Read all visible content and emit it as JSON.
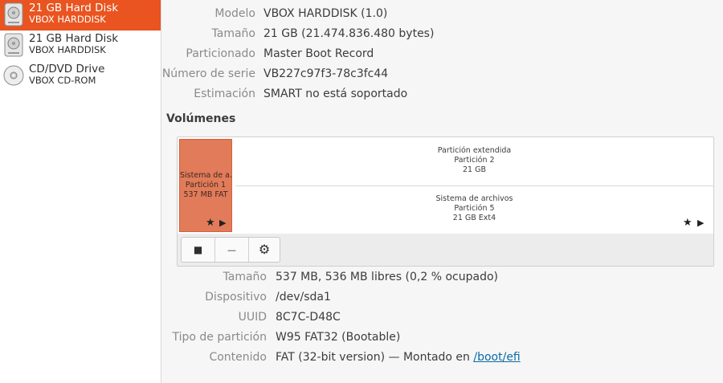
{
  "sidebar": {
    "items": [
      {
        "name": "21 GB Hard Disk",
        "sub": "VBOX HARDDISK",
        "icon": "hard-disk-icon",
        "selected": true
      },
      {
        "name": "21 GB Hard Disk",
        "sub": "VBOX HARDDISK",
        "icon": "hard-disk-icon",
        "selected": false
      },
      {
        "name": "CD/DVD Drive",
        "sub": "VBOX CD-ROM",
        "icon": "optical-drive-icon",
        "selected": false
      }
    ]
  },
  "disk_info": {
    "model_label": "Modelo",
    "model_value": "VBOX HARDDISK (1.0)",
    "size_label": "Tamaño",
    "size_value": "21 GB (21.474.836.480 bytes)",
    "partitioning_label": "Particionado",
    "partitioning_value": "Master Boot Record",
    "serial_label": "Número de serie",
    "serial_value": "VB227c97f3-78c3fc44",
    "assessment_label": "Estimación",
    "assessment_value": "SMART no está soportado"
  },
  "volumes": {
    "title": "Volúmenes",
    "partition1": {
      "line1": "Sistema de a...",
      "line2": "Partición 1",
      "line3": "537 MB FAT"
    },
    "extended": {
      "line1": "Partición extendida",
      "line2": "Partición 2",
      "line3": "21 GB"
    },
    "logical": {
      "line1": "Sistema de archivos",
      "line2": "Partición 5",
      "line3": "21 GB Ext4"
    },
    "star_glyph": "★",
    "play_glyph": "▶",
    "toolbar": {
      "stop_glyph": "■",
      "minus_glyph": "—",
      "gear_glyph": "⚙"
    }
  },
  "selected_partition": {
    "size_label": "Tamaño",
    "size_value": "537 MB, 536 MB libres (0,2 % ocupado)",
    "device_label": "Dispositivo",
    "device_value": "/dev/sda1",
    "uuid_label": "UUID",
    "uuid_value": "8C7C-D48C",
    "type_label": "Tipo de partición",
    "type_value": "W95 FAT32 (Bootable)",
    "contents_label": "Contenido",
    "contents_value": "FAT (32-bit version) — Montado en ",
    "contents_link": "/boot/efi"
  },
  "colors": {
    "accent": "#e95420",
    "partition_selected": "#e27b59",
    "link": "#0b6aa8"
  }
}
